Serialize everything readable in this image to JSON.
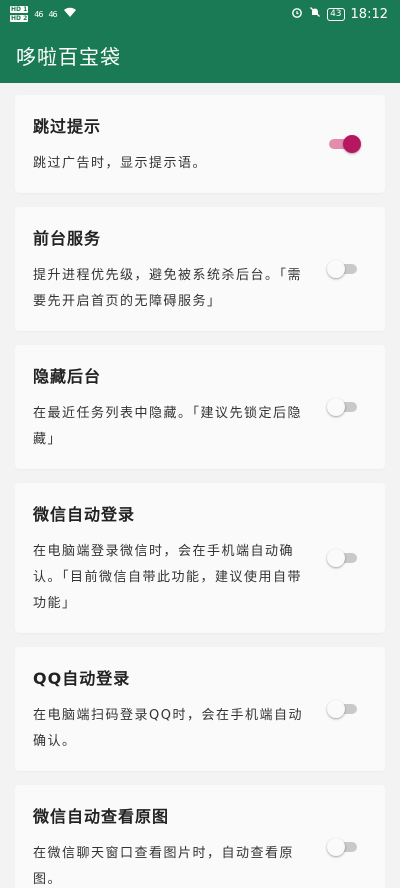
{
  "status": {
    "sim1": "HD 1",
    "sim2": "HD 2",
    "signal1": "46",
    "signal2": "46",
    "battery": "43",
    "time": "18:12"
  },
  "app": {
    "title": "哆啦百宝袋"
  },
  "colors": {
    "primary": "#1b7a56",
    "accent": "#b5185f",
    "card": "#fafafa"
  },
  "settings": [
    {
      "title": "跳过提示",
      "desc": "跳过广告时，显示提示语。",
      "enabled": true
    },
    {
      "title": "前台服务",
      "desc": "提升进程优先级，避免被系统杀后台。「需要先开启首页的无障碍服务」",
      "enabled": false
    },
    {
      "title": "隐藏后台",
      "desc": "在最近任务列表中隐藏。「建议先锁定后隐藏」",
      "enabled": false
    },
    {
      "title": "微信自动登录",
      "desc": "在电脑端登录微信时，会在手机端自动确认。「目前微信自带此功能，建议使用自带功能」",
      "enabled": false
    },
    {
      "title": "QQ自动登录",
      "desc": "在电脑端扫码登录QQ时，会在手机端自动确认。",
      "enabled": false
    },
    {
      "title": "微信自动查看原图",
      "desc": "在微信聊天窗口查看图片时，自动查看原图。",
      "enabled": false
    }
  ]
}
